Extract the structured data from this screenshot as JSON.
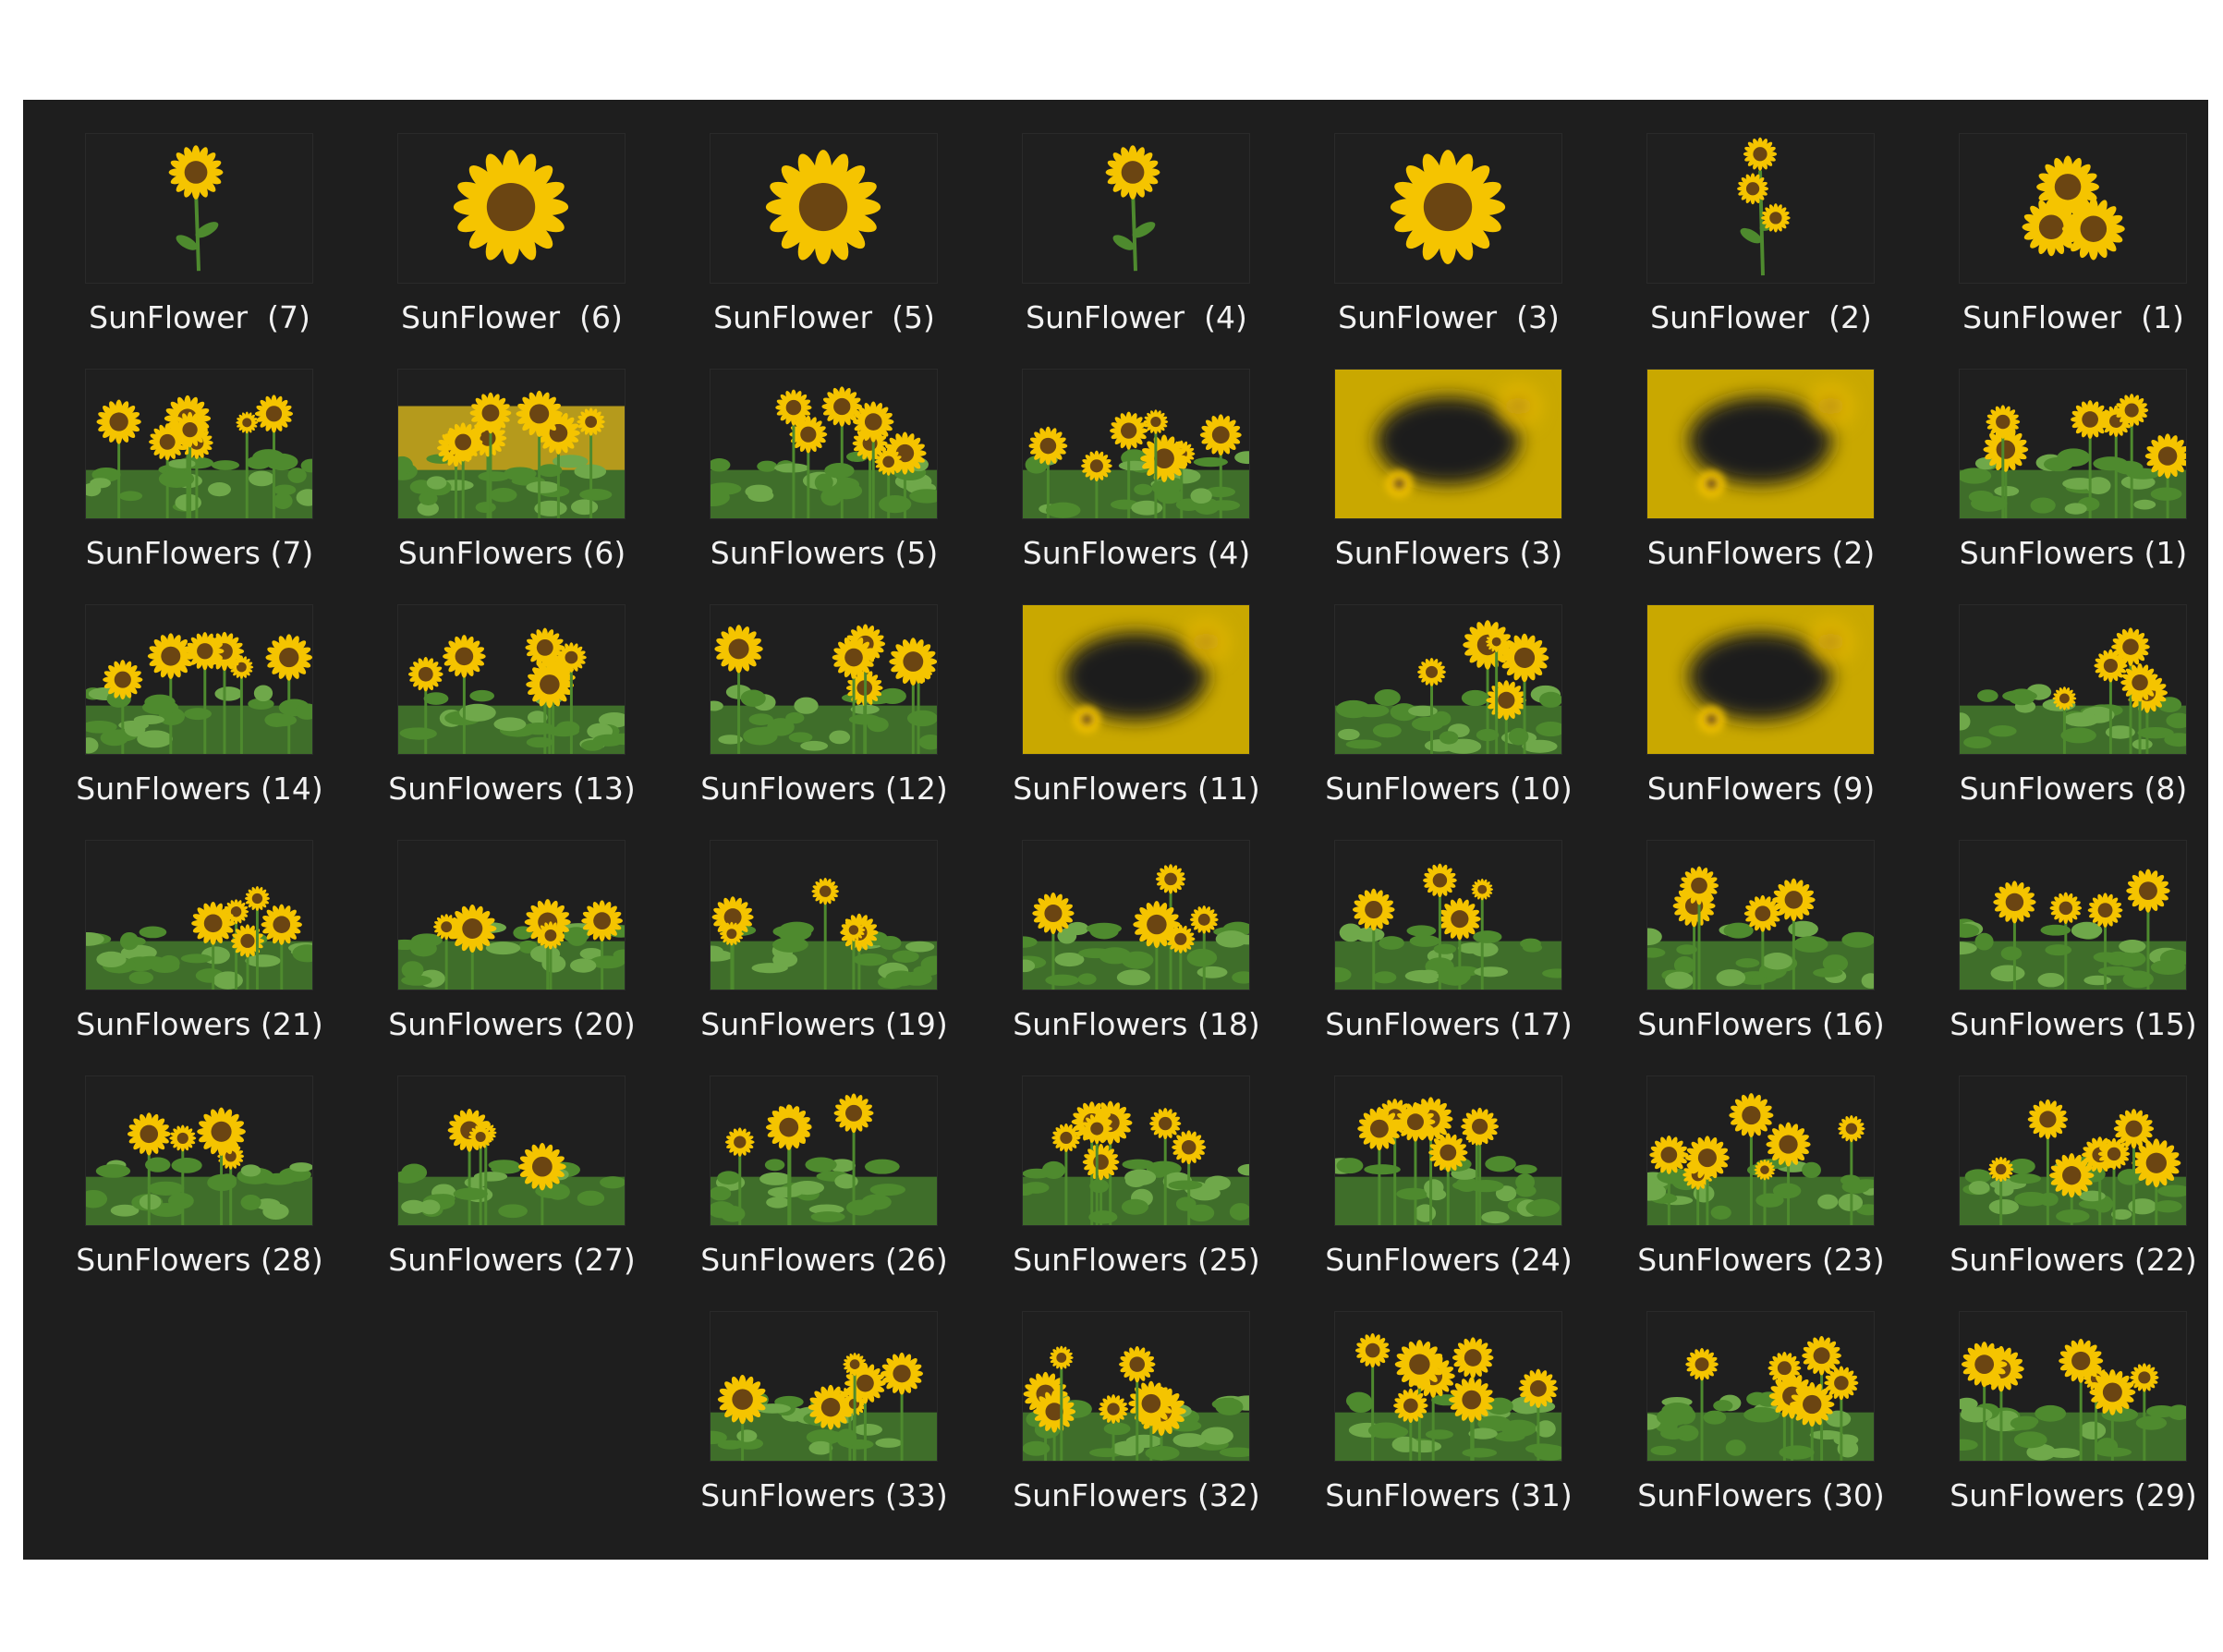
{
  "rows": [
    [
      {
        "label": "SunFlower  (7)",
        "icon": "single-sunflower-stem"
      },
      {
        "label": "SunFlower  (6)",
        "icon": "sunflower-head"
      },
      {
        "label": "SunFlower  (5)",
        "icon": "sunflower-head"
      },
      {
        "label": "SunFlower  (4)",
        "icon": "single-sunflower-stem"
      },
      {
        "label": "SunFlower  (3)",
        "icon": "sunflower-head"
      },
      {
        "label": "SunFlower  (2)",
        "icon": "sunflower-cluster-stem"
      },
      {
        "label": "SunFlower  (1)",
        "icon": "sunflower-cluster"
      }
    ],
    [
      {
        "label": "SunFlowers (7)",
        "icon": "sunflower-field"
      },
      {
        "label": "SunFlowers (6)",
        "icon": "sunflower-field-bright"
      },
      {
        "label": "SunFlowers (5)",
        "icon": "sunflower-field-dark"
      },
      {
        "label": "SunFlowers (4)",
        "icon": "sunflower-field"
      },
      {
        "label": "SunFlowers (3)",
        "icon": "blurred-sunflower-frame"
      },
      {
        "label": "SunFlowers (2)",
        "icon": "blurred-sunflower-frame"
      },
      {
        "label": "SunFlowers (1)",
        "icon": "sunflower-field"
      }
    ],
    [
      {
        "label": "SunFlowers (14)",
        "icon": "sunflower-field"
      },
      {
        "label": "SunFlowers (13)",
        "icon": "sunflower-field"
      },
      {
        "label": "SunFlowers (12)",
        "icon": "sunflower-field"
      },
      {
        "label": "SunFlowers (11)",
        "icon": "blurred-sunflower-frame"
      },
      {
        "label": "SunFlowers (10)",
        "icon": "sunflower-field"
      },
      {
        "label": "SunFlowers (9)",
        "icon": "blurred-sunflower-frame"
      },
      {
        "label": "SunFlowers (8)",
        "icon": "sunflower-field"
      }
    ],
    [
      {
        "label": "SunFlowers (21)",
        "icon": "sunflower-field"
      },
      {
        "label": "SunFlowers (20)",
        "icon": "sunflower-field"
      },
      {
        "label": "SunFlowers (19)",
        "icon": "sunflower-field"
      },
      {
        "label": "SunFlowers (18)",
        "icon": "sunflower-field"
      },
      {
        "label": "SunFlowers (17)",
        "icon": "sunflower-field"
      },
      {
        "label": "SunFlowers (16)",
        "icon": "sunflower-field"
      },
      {
        "label": "SunFlowers (15)",
        "icon": "sunflower-field"
      }
    ],
    [
      {
        "label": "SunFlowers (28)",
        "icon": "sunflower-field"
      },
      {
        "label": "SunFlowers (27)",
        "icon": "sunflower-field"
      },
      {
        "label": "SunFlowers (26)",
        "icon": "sunflower-field"
      },
      {
        "label": "SunFlowers (25)",
        "icon": "sunflower-field"
      },
      {
        "label": "SunFlowers (24)",
        "icon": "sunflower-field"
      },
      {
        "label": "SunFlowers (23)",
        "icon": "sunflower-field"
      },
      {
        "label": "SunFlowers (22)",
        "icon": "sunflower-field"
      }
    ],
    [
      null,
      null,
      {
        "label": "SunFlowers (33)",
        "icon": "sunflower-field"
      },
      {
        "label": "SunFlowers (32)",
        "icon": "sunflower-field"
      },
      {
        "label": "SunFlowers (31)",
        "icon": "sunflower-field"
      },
      {
        "label": "SunFlowers (30)",
        "icon": "sunflower-field"
      },
      {
        "label": "SunFlowers (29)",
        "icon": "sunflower-field"
      }
    ]
  ],
  "colors": {
    "panel": "#1e1e1e",
    "label": "#f2f2f2",
    "petal": "#f5c400",
    "center": "#6b4512",
    "leaf": "#4e8a2e"
  }
}
